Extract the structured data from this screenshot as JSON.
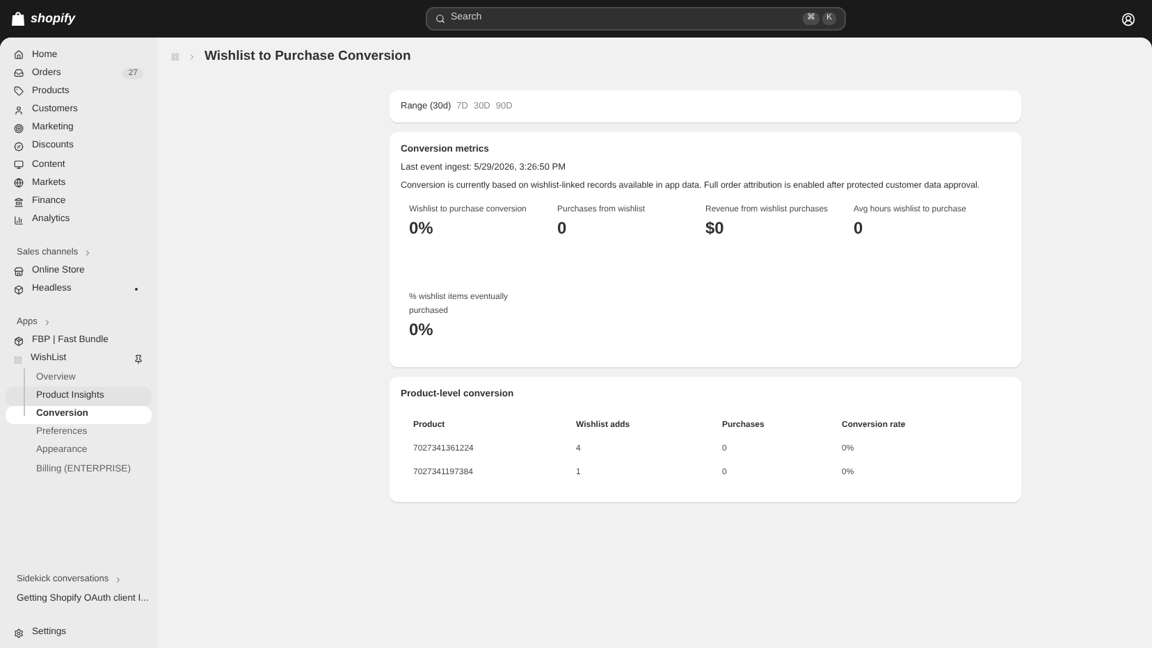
{
  "topbar": {
    "logo_text": "shopify",
    "search": {
      "placeholder": "Search"
    },
    "shortcut": [
      "⌘",
      "K"
    ]
  },
  "sidebar": {
    "nav": [
      {
        "label": "Home"
      },
      {
        "label": "Orders",
        "badge": "27"
      },
      {
        "label": "Products"
      },
      {
        "label": "Customers"
      },
      {
        "label": "Marketing"
      },
      {
        "label": "Discounts"
      },
      {
        "label": "Content"
      },
      {
        "label": "Markets"
      },
      {
        "label": "Finance"
      },
      {
        "label": "Analytics"
      }
    ],
    "sales_channels": {
      "heading": "Sales channels",
      "items": [
        {
          "label": "Online Store",
          "indicator": false
        },
        {
          "label": "Headless",
          "indicator": true
        }
      ]
    },
    "apps": {
      "heading": "Apps",
      "items": [
        {
          "label": "FBP | Fast Bundle",
          "pinned": false
        },
        {
          "label": "WishList",
          "pinned": true,
          "children": [
            {
              "label": "Overview",
              "selected": false,
              "hovered": false
            },
            {
              "label": "Product Insights",
              "selected": false,
              "hovered": true
            },
            {
              "label": "Conversion",
              "selected": true,
              "hovered": false
            },
            {
              "label": "Preferences",
              "selected": false,
              "hovered": false
            },
            {
              "label": "Appearance",
              "selected": false,
              "hovered": false
            },
            {
              "label": "Billing (ENTERPRISE)",
              "selected": false,
              "hovered": false
            }
          ]
        }
      ]
    },
    "sidekick": {
      "heading": "Sidekick conversations",
      "items": [
        "Getting Shopify OAuth client I..."
      ]
    },
    "settings": "Settings"
  },
  "page": {
    "title": "Wishlist to Purchase Conversion",
    "range": {
      "label": "Range (30d)",
      "options": [
        "7D",
        "30D",
        "90D"
      ]
    },
    "metrics_card": {
      "title": "Conversion metrics",
      "ingest": "Last event ingest: 5/29/2026, 3:26:50 PM",
      "note": "Conversion is currently based on wishlist-linked records available in app data. Full order attribution is enabled after protected customer data approval.",
      "metrics": [
        {
          "label": "Wishlist to purchase conversion",
          "value": "0%"
        },
        {
          "label": "Purchases from wishlist",
          "value": "0"
        },
        {
          "label": "Revenue from wishlist purchases",
          "value": "$0"
        },
        {
          "label": "Avg hours wishlist to purchase",
          "value": "0"
        },
        {
          "label": "% wishlist items eventually purchased",
          "value": "0%"
        }
      ]
    },
    "product_card": {
      "title": "Product-level conversion",
      "columns": [
        "Product",
        "Wishlist adds",
        "Purchases",
        "Conversion rate"
      ],
      "rows": [
        [
          "7027341361224",
          "4",
          "0",
          "0%"
        ],
        [
          "7027341197384",
          "1",
          "0",
          "0%"
        ]
      ]
    }
  }
}
